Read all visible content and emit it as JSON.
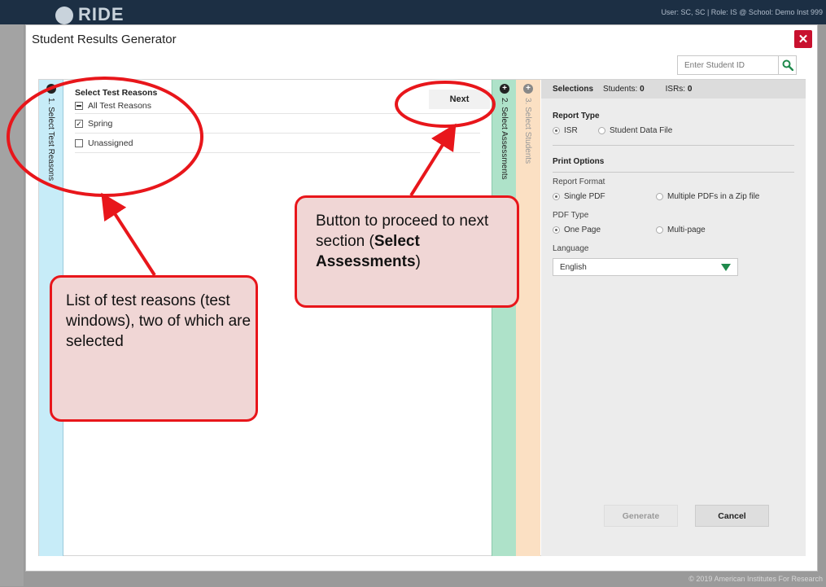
{
  "background": {
    "brand": "RIDE",
    "user_info": "User: SC, SC | Role: IS @ School: Demo Inst 999",
    "footer": "© 2019 American Institutes For Research"
  },
  "modal": {
    "title": "Student Results Generator",
    "close_icon": "close-icon",
    "search": {
      "placeholder": "Enter Student ID",
      "icon": "search-icon"
    }
  },
  "tabs": [
    {
      "label": "1. Select Test Reasons",
      "icon": "minus-circle-icon",
      "color": "#c7ecf8"
    },
    {
      "label": "2. Select Assessments",
      "icon": "plus-circle-icon",
      "color": "#aee2c9"
    },
    {
      "label": "3. Select Students",
      "icon": "plus-circle-icon",
      "color": "#fbe0c3"
    }
  ],
  "test_reasons": {
    "heading": "Select Test Reasons",
    "items": [
      {
        "label": "All Test Reasons",
        "state": "partial"
      },
      {
        "label": "Spring",
        "state": "checked"
      },
      {
        "label": "Unassigned",
        "state": "unchecked"
      }
    ],
    "next_label": "Next"
  },
  "selections": {
    "title": "Selections",
    "students_label": "Students:",
    "students_value": "0",
    "isrs_label": "ISRs:",
    "isrs_value": "0",
    "report_type": {
      "title": "Report Type",
      "options": [
        {
          "label": "ISR",
          "selected": true
        },
        {
          "label": "Student Data File",
          "selected": false
        }
      ]
    },
    "print_options": {
      "title": "Print Options",
      "report_format": {
        "label": "Report Format",
        "options": [
          {
            "label": "Single PDF",
            "selected": true
          },
          {
            "label": "Multiple PDFs in a Zip file",
            "selected": false
          }
        ]
      },
      "pdf_type": {
        "label": "PDF Type",
        "options": [
          {
            "label": "One Page",
            "selected": true
          },
          {
            "label": "Multi-page",
            "selected": false
          }
        ]
      },
      "language": {
        "label": "Language",
        "value": "English"
      }
    },
    "generate_label": "Generate",
    "cancel_label": "Cancel"
  },
  "annotations": {
    "callout_1": "List of test reasons (test windows), two of which are selected",
    "callout_2_prefix": "Button to proceed to next section (",
    "callout_2_bold": "Select Assessments",
    "callout_2_suffix": ")",
    "accent_color": "#e8161b"
  }
}
